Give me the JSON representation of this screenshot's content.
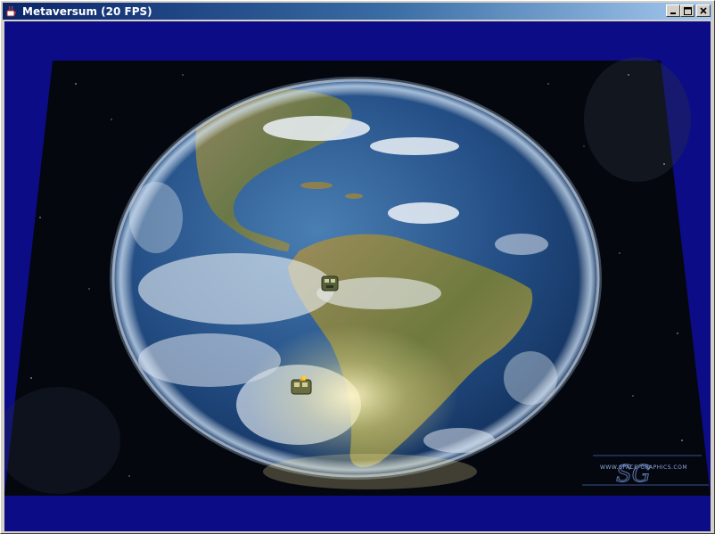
{
  "window": {
    "title": "Metaversum (20 FPS)"
  },
  "icons": {
    "app": "java-cup-icon",
    "minimize": "minimize-icon",
    "maximize": "maximize-icon",
    "close": "close-icon"
  },
  "scene": {
    "background_color": "#0c0c86",
    "space_color": "#05070f",
    "ocean_color": "#1d4f86",
    "land_color": "#8a7a4e",
    "cloud_color": "#e8eef5"
  },
  "watermark": {
    "site": "WWW.SPACE-GRAPHICS.COM",
    "logo": "SG"
  }
}
